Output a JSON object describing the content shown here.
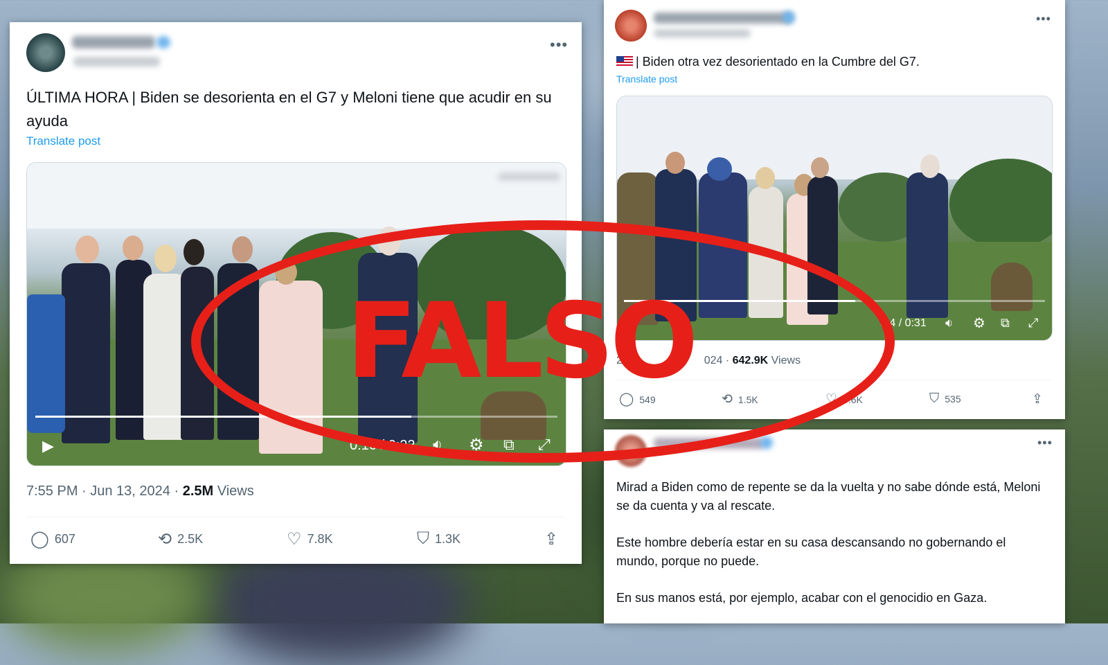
{
  "stamp": {
    "text": "FALSO",
    "color": "#e62019"
  },
  "left_post": {
    "text": "ÚLTIMA HORA | Biden se desorienta en el G7 y Meloni tiene que acudir en su ayuda",
    "translate_label": "Translate post",
    "video": {
      "time": "0:16 / 0:22",
      "progress": 0.72
    },
    "date": "7:55 PM · Jun 13, 2024 ·",
    "views_count": "2.5M",
    "views_label": "Views",
    "actions": {
      "replies": "607",
      "reposts": "2.5K",
      "likes": "7.8K",
      "bookmarks": "1.3K"
    },
    "icons": [
      "more-icon",
      "play-icon",
      "volume-icon",
      "gear-icon",
      "pip-icon",
      "fullscreen-icon",
      "reply-icon",
      "repost-icon",
      "like-icon",
      "bookmark-icon",
      "share-icon"
    ]
  },
  "right_top_post": {
    "text": "| Biden otra vez desorientado en la Cumbre del G7.",
    "translate_label": "Translate post",
    "video": {
      "time": "0:4 / 0:31",
      "progress": 0.55
    },
    "date": "26",
    "date_tail": "024 ·",
    "views_count": "642.9K",
    "views_label": "Views",
    "actions": {
      "replies": "549",
      "reposts": "1.5K",
      "likes": "6.6K",
      "bookmarks": "535"
    },
    "accent": "#1d9bf0"
  },
  "right_bottom_post": {
    "paragraph1": "Mirad a Biden como de repente se da la vuelta y no sabe dónde está, Meloni se da cuenta y va al rescate.",
    "paragraph2": "Este hombre debería estar en su casa descansando no gobernando el mundo, porque no puede.",
    "paragraph3": "En sus manos está, por ejemplo, acabar con el genocidio en Gaza."
  }
}
